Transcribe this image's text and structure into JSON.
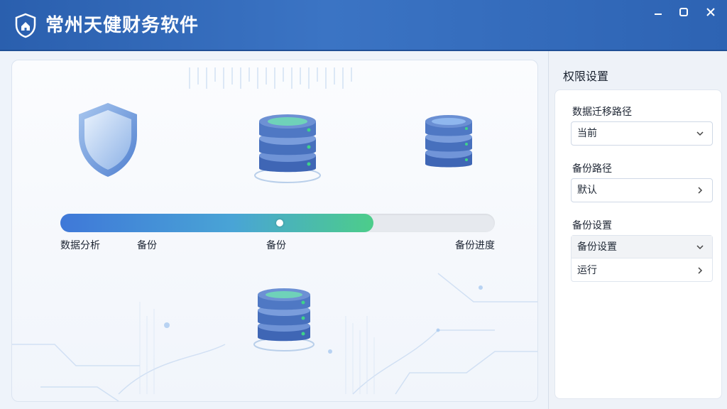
{
  "window": {
    "title": "常州天健财务软件"
  },
  "progress": {
    "value_fraction": 0.72,
    "steps": [
      "数据分析",
      "备份",
      "备份",
      "备份进度"
    ]
  },
  "side_panel": {
    "title": "权限设置",
    "fields": [
      {
        "label": "数据迁移路径",
        "value": "当前",
        "control": "dropdown"
      },
      {
        "label": "备份路径",
        "value": "默认",
        "control": "link"
      }
    ],
    "group": {
      "label": "备份设置",
      "items": [
        {
          "value": "备份设置",
          "control": "dropdown"
        },
        {
          "value": "运行",
          "control": "link"
        }
      ]
    }
  },
  "colors": {
    "titlebar": "#2f68b8",
    "progress_start": "#3f78d8",
    "progress_end": "#4ccd8a",
    "accent_green": "#3fd28a"
  }
}
